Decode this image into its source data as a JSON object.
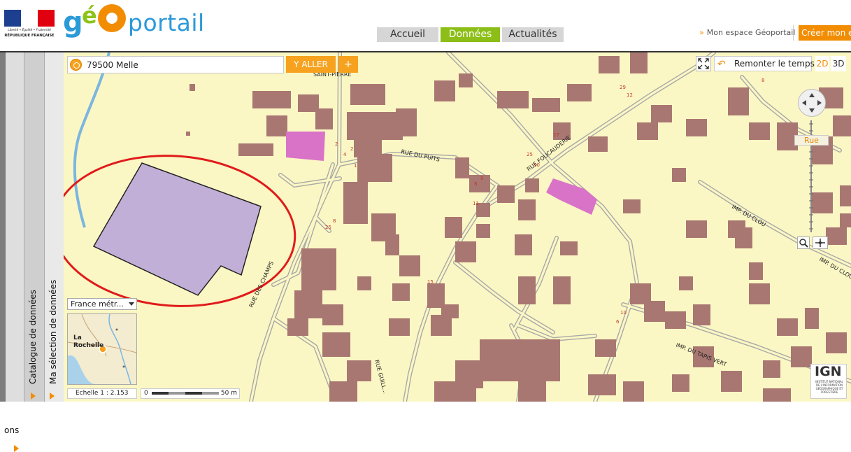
{
  "header": {
    "republique": {
      "line1": "Liberté • Égalité • Fraternité",
      "line2": "RÉPUBLIQUE FRANÇAISE"
    },
    "logo": {
      "g": "g",
      "e": "é",
      "rest": "portail"
    },
    "nav": [
      {
        "label": "Accueil"
      },
      {
        "label": "Données",
        "active": true
      },
      {
        "label": "Actualités"
      }
    ],
    "mon_espace": "Mon espace Géoportail",
    "creer": "Créer mon es"
  },
  "side_panels": {
    "ons": "ons",
    "catalogue": "Catalogue de données",
    "selection": "Ma sélection de données"
  },
  "map": {
    "search": {
      "value": "79500 Melle"
    },
    "yaller": "Y ALLER",
    "plus": "+",
    "remonter": "Remonter le temps",
    "view_2d": "2D",
    "view_3d": "3D",
    "zoom_label": "Rue",
    "territory": "France métr...",
    "minimap_label": "La\nRochelle",
    "scale_text": "Echelle 1 :  2.153",
    "scale_bar": {
      "start": "0",
      "end": "50 m"
    },
    "ign": {
      "title": "IGN",
      "subtitle": "INSTITUT NATIONAL DE L'INFORMATION GÉOGRAPHIQUE ET FORESTIÈRE"
    },
    "streets": [
      "SAINT-PIERRE",
      "RUE DU PUITS",
      "RUE FOUCAUDERIE",
      "IMP. DU CLOU",
      "IMP. DU CLOU",
      "RUE DES CHAMPS",
      "IMP. DU TAPIS VERT",
      "RUE GUILL..."
    ],
    "house_numbers": [
      "29",
      "12",
      "27",
      "25",
      "10",
      "9",
      "8",
      "4",
      "2",
      "2",
      "1",
      "25",
      "8",
      "15",
      "11",
      "10",
      "6",
      "8"
    ]
  },
  "colors": {
    "accent_orange": "#f28c00",
    "green_tab": "#8cbe17",
    "building": "#a97772",
    "special_building": "#d873c8",
    "selected_parcel": "#c2afd7",
    "highlight_ellipse": "#e01b1b",
    "map_background": "#fbf7c4"
  }
}
